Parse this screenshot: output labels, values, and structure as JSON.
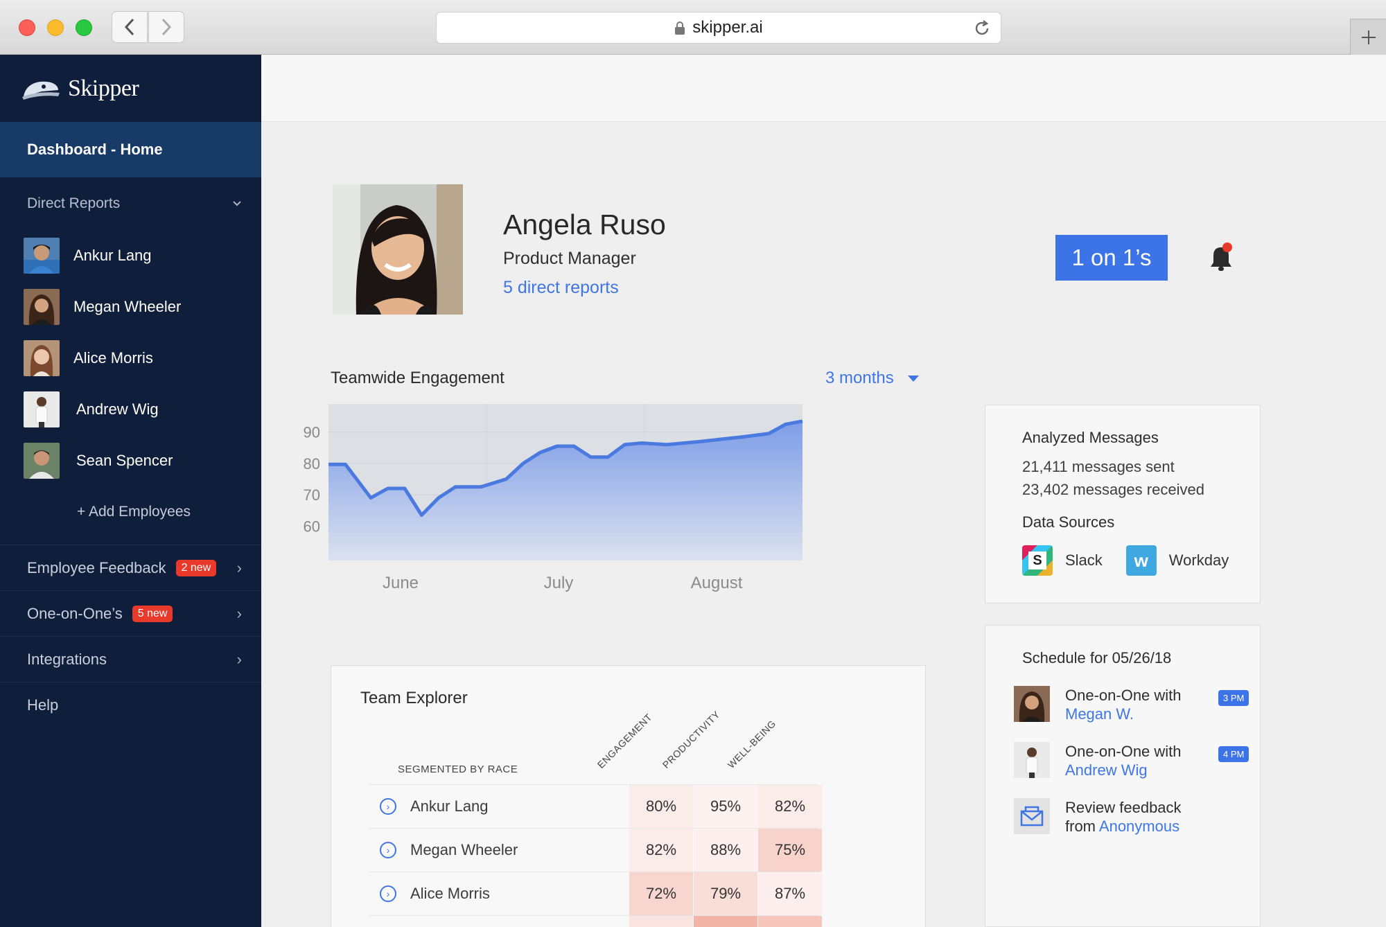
{
  "browser": {
    "url": "skipper.ai"
  },
  "sidebar": {
    "brand": "Skipper",
    "home": "Dashboard - Home",
    "direct_reports_label": "Direct Reports",
    "reports": [
      {
        "name": "Ankur Lang"
      },
      {
        "name": "Megan Wheeler"
      },
      {
        "name": "Alice Morris"
      },
      {
        "name": "Andrew Wig"
      },
      {
        "name": "Sean Spencer"
      }
    ],
    "add_employees": "+ Add Employees",
    "nav": [
      {
        "label": "Employee Feedback",
        "badge": "2 new"
      },
      {
        "label": "One-on-One’s",
        "badge": "5 new"
      },
      {
        "label": "Integrations",
        "badge": null
      },
      {
        "label": "Help",
        "badge": null
      }
    ]
  },
  "profile": {
    "name": "Angela Ruso",
    "role": "Product Manager",
    "reports_link": "5 direct reports",
    "one_on_one_button": "1 on 1’s"
  },
  "engagement": {
    "title": "Teamwide Engagement",
    "range": "3 months"
  },
  "chart_data": {
    "type": "area",
    "title": "Teamwide Engagement",
    "xlabel": "",
    "ylabel": "",
    "x_tick_labels": [
      "June",
      "July",
      "August"
    ],
    "y_ticks": [
      60,
      70,
      80,
      90
    ],
    "ylim": [
      49,
      99
    ],
    "grid": true,
    "x": [
      0,
      1,
      2.5,
      3.5,
      4.5,
      5.5,
      6.5,
      7.5,
      9,
      10.5,
      11.5,
      12.5,
      13.5,
      14.5,
      15.5,
      16.5,
      17.5,
      18.5,
      20,
      22,
      24.5,
      26,
      27,
      28
    ],
    "values": [
      79.7,
      79.7,
      69,
      72,
      72,
      63.5,
      69,
      72.5,
      72.5,
      75,
      80,
      83.5,
      85.5,
      85.5,
      82,
      82,
      86,
      86.5,
      86,
      87,
      88.5,
      89.5,
      92.5,
      93.5
    ],
    "series_color": "#4a79e0"
  },
  "messages": {
    "title": "Analyzed Messages",
    "sent": "21,411 messages sent",
    "received": "23,402 messages received",
    "sources_title": "Data Sources",
    "sources": [
      {
        "name": "Slack"
      },
      {
        "name": "Workday"
      }
    ]
  },
  "schedule": {
    "title": "Schedule for 05/26/18",
    "items": [
      {
        "text": "One-on-One with",
        "who": "Megan W.",
        "time": "3 PM"
      },
      {
        "text": "One-on-One with",
        "who": "Andrew Wig",
        "time": "4 PM"
      },
      {
        "text": "Review feedback",
        "text2": "from",
        "who": "Anonymous",
        "time": ""
      }
    ]
  },
  "team_explorer": {
    "title": "Team Explorer",
    "segment_label": "SEGMENTED BY RACE",
    "columns": [
      "ENGAGEMENT",
      "PRODUCTIVITY",
      "WELL-BEING"
    ],
    "rows": [
      {
        "name": "Ankur Lang",
        "values": [
          "80%",
          "95%",
          "82%"
        ]
      },
      {
        "name": "Megan Wheeler",
        "values": [
          "82%",
          "88%",
          "75%"
        ]
      },
      {
        "name": "Alice Morris",
        "values": [
          "72%",
          "79%",
          "87%"
        ]
      }
    ]
  }
}
